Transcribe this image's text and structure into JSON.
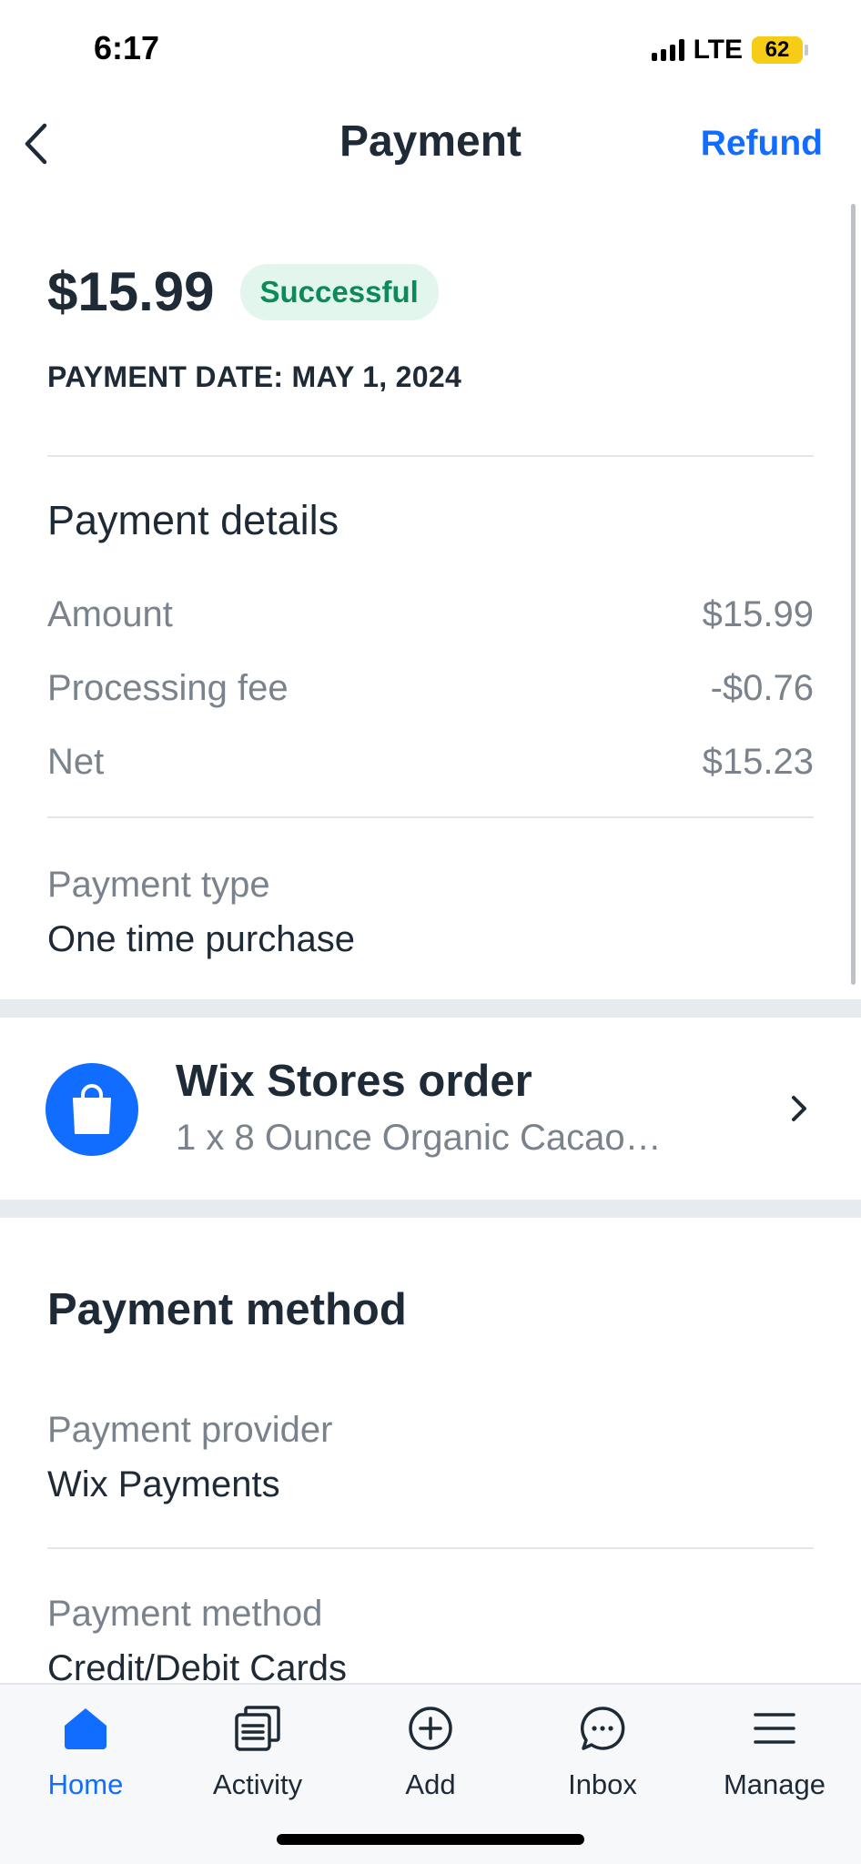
{
  "status_bar": {
    "time": "6:17",
    "network": "LTE",
    "battery": "62"
  },
  "header": {
    "title": "Payment",
    "refund_label": "Refund"
  },
  "summary": {
    "amount": "$15.99",
    "status": "Successful",
    "payment_date": "PAYMENT DATE: MAY 1, 2024"
  },
  "payment_details": {
    "title": "Payment details",
    "rows": [
      {
        "label": "Amount",
        "value": "$15.99"
      },
      {
        "label": "Processing fee",
        "value": "-$0.76"
      },
      {
        "label": "Net",
        "value": "$15.23"
      }
    ],
    "type_label": "Payment type",
    "type_value": "One time purchase"
  },
  "order": {
    "title": "Wix Stores order",
    "subtitle": "1 x 8 Ounce Organic Cacao…"
  },
  "payment_method": {
    "title": "Payment method",
    "provider_label": "Payment provider",
    "provider_value": "Wix Payments",
    "method_label": "Payment method",
    "method_value": "Credit/Debit Cards"
  },
  "tabs": [
    {
      "label": "Home",
      "icon": "home-icon",
      "active": true
    },
    {
      "label": "Activity",
      "icon": "activity-icon",
      "active": false
    },
    {
      "label": "Add",
      "icon": "add-icon",
      "active": false
    },
    {
      "label": "Inbox",
      "icon": "inbox-icon",
      "active": false
    },
    {
      "label": "Manage",
      "icon": "menu-icon",
      "active": false
    }
  ],
  "colors": {
    "accent": "#116dff",
    "success_text": "#0d8a5a",
    "success_bg": "#e3f6ee",
    "battery": "#f7cc16"
  }
}
